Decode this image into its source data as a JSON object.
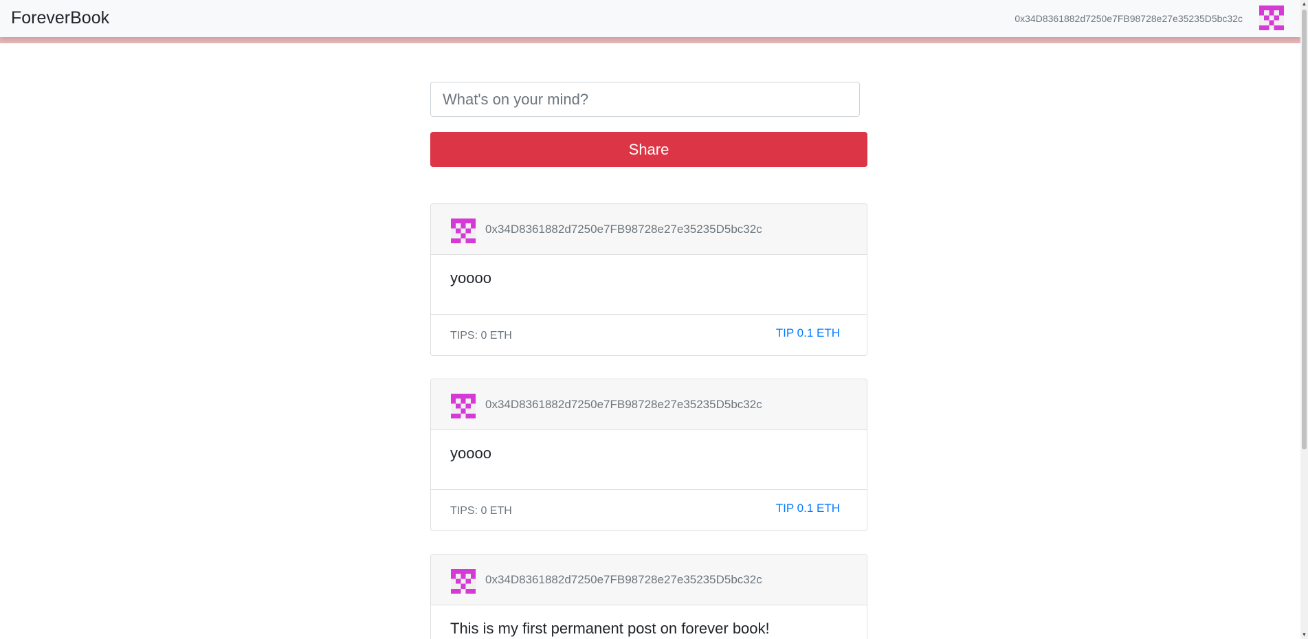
{
  "navbar": {
    "brand": "ForeverBook",
    "account_address": "0x34D8361882d7250e7FB98728e27e35235D5bc32c",
    "avatar_icon": "identicon-icon"
  },
  "compose": {
    "placeholder": "What's on your mind?",
    "value": "",
    "share_label": "Share"
  },
  "colors": {
    "accent": "#dc3545",
    "link": "#007bff",
    "identicon": "#d63ad6",
    "navbar_stripe": "#e6b8b8"
  },
  "posts": [
    {
      "author": "0x34D8361882d7250e7FB98728e27e35235D5bc32c",
      "content": "yoooo",
      "tips": "TIPS: 0 ETH",
      "tip_label": "TIP 0.1 ETH"
    },
    {
      "author": "0x34D8361882d7250e7FB98728e27e35235D5bc32c",
      "content": "yoooo",
      "tips": "TIPS: 0 ETH",
      "tip_label": "TIP 0.1 ETH"
    },
    {
      "author": "0x34D8361882d7250e7FB98728e27e35235D5bc32c",
      "content": "This is my first permanent post on forever book!"
    }
  ]
}
